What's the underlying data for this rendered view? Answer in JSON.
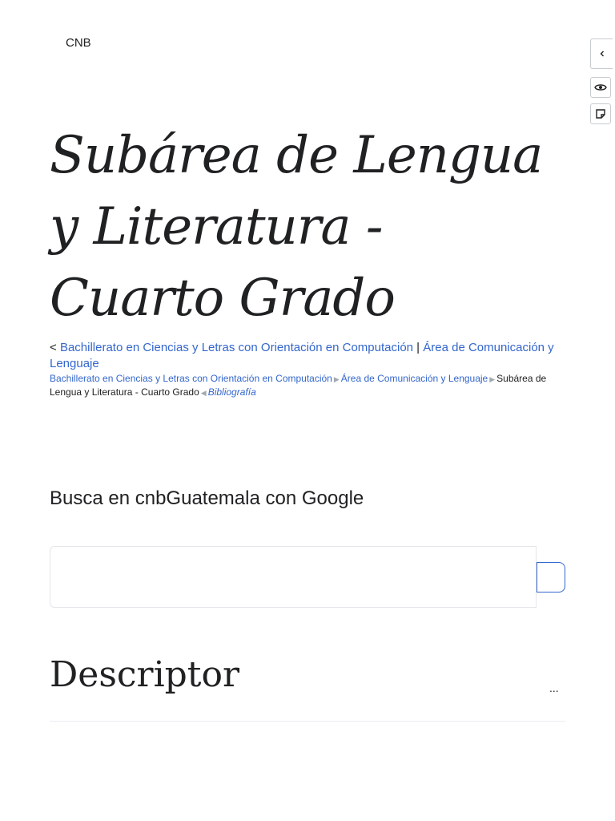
{
  "header": {
    "site_name": "CNB"
  },
  "side_tools": {
    "collapse_icon": "chevron-left-icon",
    "watch_icon": "eye-icon",
    "notes_icon": "note-icon"
  },
  "page": {
    "title": "Subárea de Lengua y Literatura - Cuarto Grado"
  },
  "subpages": {
    "prefix": "< ",
    "link1": "Bachillerato en Ciencias y Letras con Orientación en Computación",
    "separator": " | ",
    "link2": "Área de Comunicación y Lenguaje"
  },
  "breadcrumb": {
    "item1": "Bachillerato en Ciencias y Letras con Orientación en Computación",
    "item2": "Área de Comunicación y Lenguaje",
    "current": "Subárea de Lengua y Literatura - Cuarto Grado",
    "next": "Bibliografía"
  },
  "search": {
    "heading": "Busca en cnbGuatemala con Google",
    "value": ""
  },
  "section": {
    "heading": "Descriptor",
    "more": "..."
  },
  "colors": {
    "link": "#3366cc",
    "text": "#202122",
    "border": "#c8ccd1"
  }
}
